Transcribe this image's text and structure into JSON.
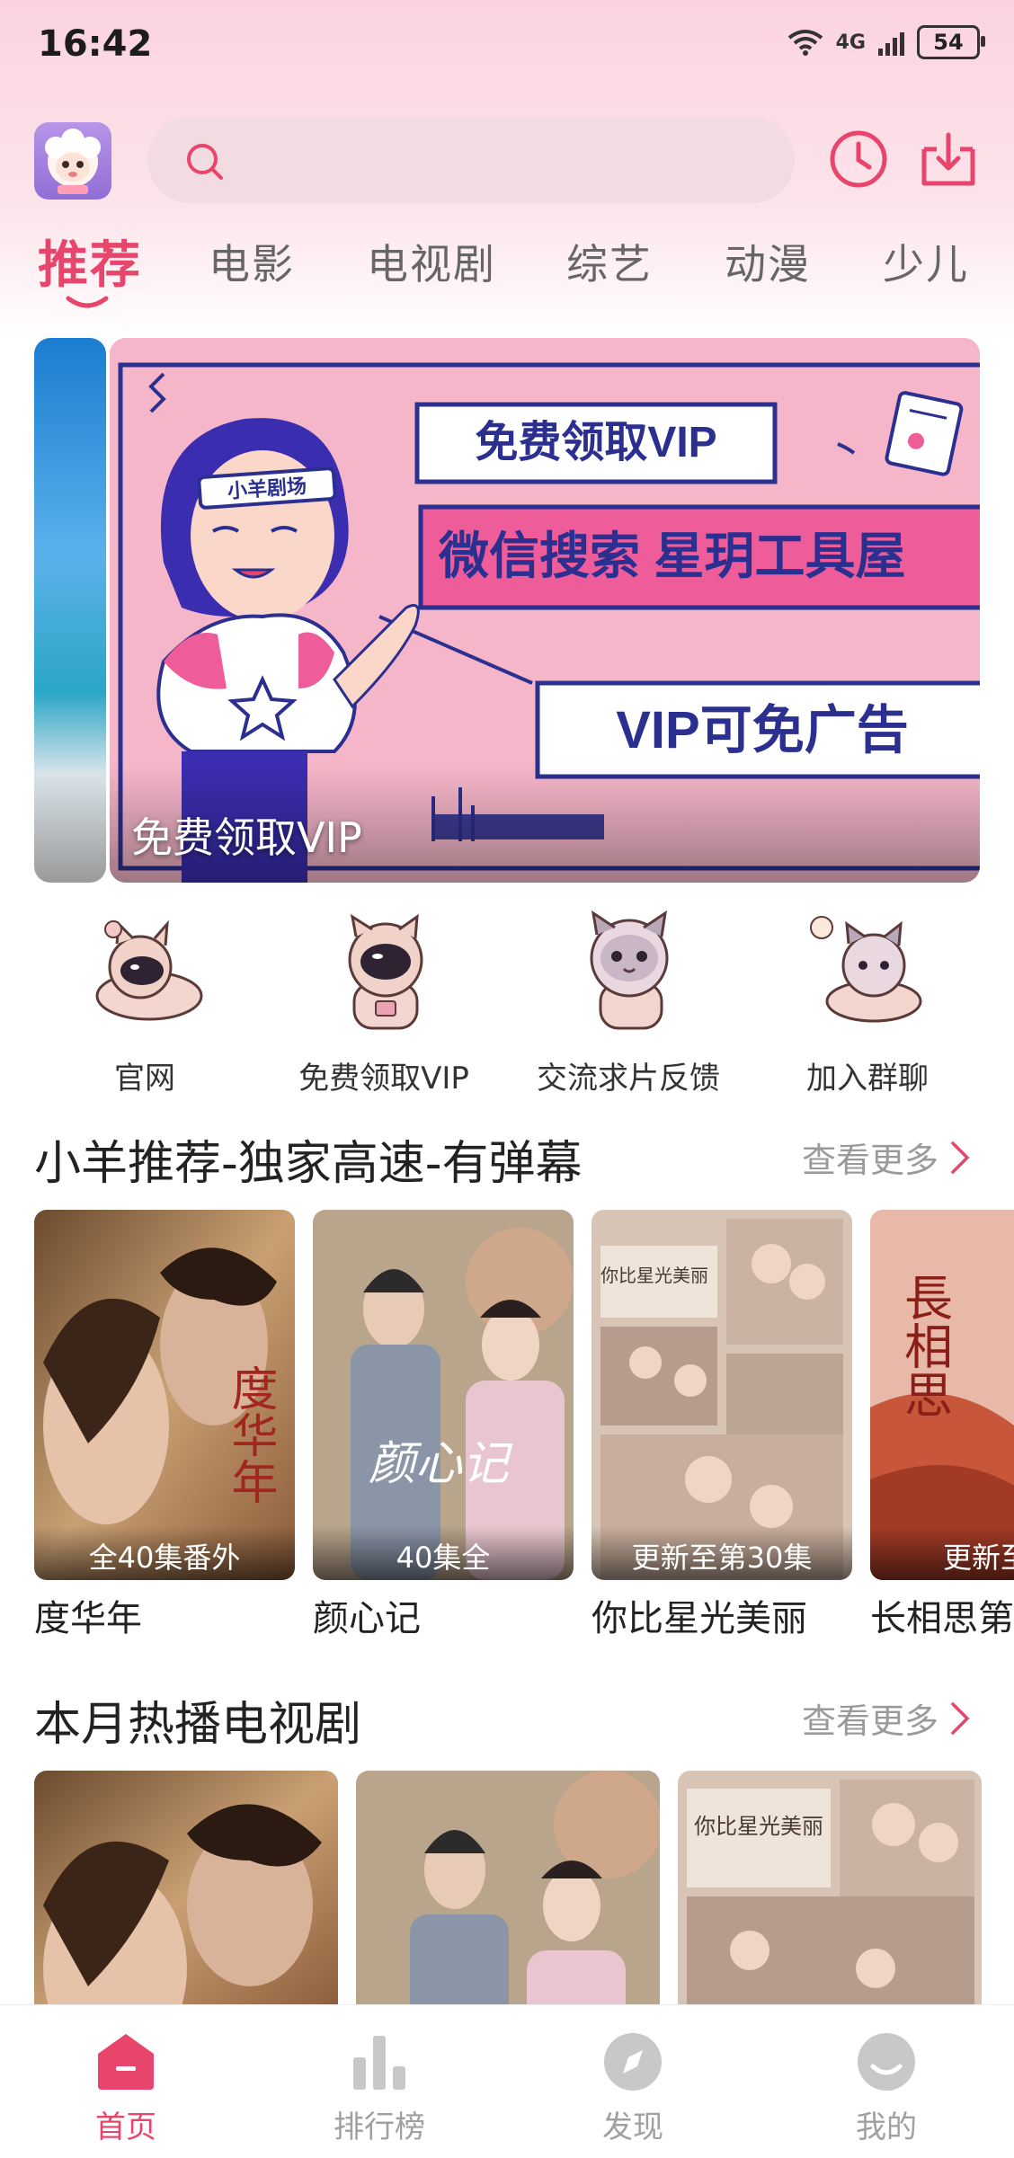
{
  "status_bar": {
    "time": "16:42",
    "network": "4G",
    "battery": "54"
  },
  "header": {
    "search_placeholder": ""
  },
  "tabs": [
    {
      "label": "推荐",
      "active": true
    },
    {
      "label": "电影"
    },
    {
      "label": "电视剧"
    },
    {
      "label": "综艺"
    },
    {
      "label": "动漫"
    },
    {
      "label": "少儿"
    }
  ],
  "banner": {
    "caption": "免费领取VIP",
    "headband_text": "小羊剧场",
    "box1": "免费领取VIP",
    "box2": "微信搜索 星玥工具屋",
    "box3": "VIP可免广告"
  },
  "quick_links": [
    {
      "label": "官网",
      "icon": "cat-astronaut-icon"
    },
    {
      "label": "免费领取VIP",
      "icon": "cat-astronaut-icon"
    },
    {
      "label": "交流求片反馈",
      "icon": "cat-astronaut-icon"
    },
    {
      "label": "加入群聊",
      "icon": "cat-astronaut-icon"
    }
  ],
  "section1": {
    "title": "小羊推荐-独家高速-有弹幕",
    "more": "查看更多",
    "items": [
      {
        "name": "度华年",
        "badge": "全40集番外",
        "poster_art": "度华年"
      },
      {
        "name": "颜心记",
        "badge": "40集全",
        "poster_art": "颜心记"
      },
      {
        "name": "你比星光美丽",
        "badge": "更新至第30集",
        "poster_art": "你比星光美丽"
      },
      {
        "name": "长相思第",
        "badge": "更新至第",
        "poster_art": "長相思"
      }
    ]
  },
  "section2": {
    "title": "本月热播电视剧",
    "more": "查看更多",
    "poster_text": "你比星光美丽"
  },
  "bottom_nav": [
    {
      "label": "首页",
      "active": true
    },
    {
      "label": "排行榜"
    },
    {
      "label": "发现"
    },
    {
      "label": "我的"
    }
  ],
  "colors": {
    "accent": "#e8456d",
    "pink_bg": "#fbd3df"
  }
}
